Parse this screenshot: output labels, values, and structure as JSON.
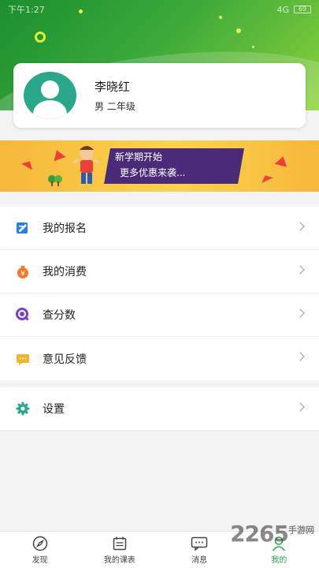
{
  "status_bar": {
    "time": "下午1:27",
    "signal": "4G",
    "battery": "69"
  },
  "profile": {
    "name": "李晓红",
    "subtitle": "男 二年级"
  },
  "banner": {
    "line1": "新学期开始",
    "line2": "更多优惠来袭..."
  },
  "menu": {
    "items": [
      {
        "label": "我的报名",
        "icon": "edit-icon",
        "color": "#2a7de1"
      },
      {
        "label": "我的消费",
        "icon": "money-bag-icon",
        "color": "#f07a2a"
      },
      {
        "label": "查分数",
        "icon": "search-score-icon",
        "color": "#7a3fd1"
      },
      {
        "label": "意见反馈",
        "icon": "feedback-icon",
        "color": "#f3b32a"
      }
    ]
  },
  "settings": {
    "label": "设置",
    "icon": "gear-icon",
    "color": "#2aa889"
  },
  "tabbar": {
    "tabs": [
      {
        "label": "发现",
        "icon": "compass-icon"
      },
      {
        "label": "我的课表",
        "icon": "calendar-icon"
      },
      {
        "label": "消息",
        "icon": "message-icon"
      },
      {
        "label": "我的",
        "icon": "user-icon",
        "active": true
      }
    ]
  },
  "watermark": {
    "brand": "2265",
    "suffix": "手游网"
  },
  "colors": {
    "accent": "#2aa84a",
    "hero_start": "#1c8e2e",
    "hero_end": "#8bd13a"
  }
}
